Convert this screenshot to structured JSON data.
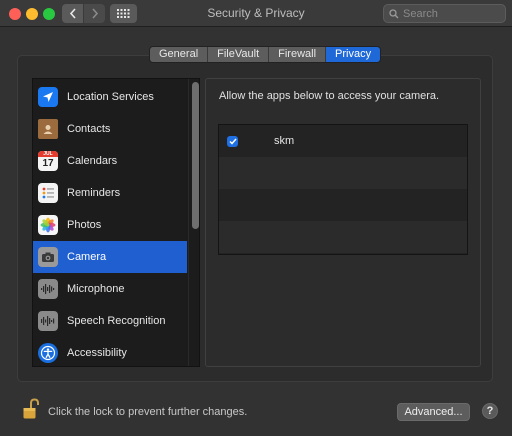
{
  "window": {
    "title": "Security & Privacy"
  },
  "search": {
    "placeholder": "Search"
  },
  "tabs": [
    {
      "label": "General"
    },
    {
      "label": "FileVault"
    },
    {
      "label": "Firewall"
    },
    {
      "label": "Privacy",
      "active": true
    }
  ],
  "sidebar": {
    "items": [
      {
        "label": "Location Services",
        "icon": "location-arrow-icon"
      },
      {
        "label": "Contacts",
        "icon": "contacts-book-icon"
      },
      {
        "label": "Calendars",
        "icon": "calendar-icon"
      },
      {
        "label": "Reminders",
        "icon": "reminders-list-icon"
      },
      {
        "label": "Photos",
        "icon": "photos-flower-icon"
      },
      {
        "label": "Camera",
        "icon": "camera-icon",
        "selected": true
      },
      {
        "label": "Microphone",
        "icon": "microphone-waveform-icon"
      },
      {
        "label": "Speech Recognition",
        "icon": "speech-waveform-icon"
      },
      {
        "label": "Accessibility",
        "icon": "accessibility-figure-icon"
      }
    ],
    "calendar_month": "JUL",
    "calendar_day": "17"
  },
  "main": {
    "description": "Allow the apps below to access your camera.",
    "apps": [
      {
        "name": "skm",
        "checked": true
      }
    ]
  },
  "footer": {
    "lock_text": "Click the lock to prevent further changes.",
    "advanced_label": "Advanced...",
    "help_label": "?"
  },
  "colors": {
    "accent": "#1f68d8",
    "selection": "#1f5fd0",
    "background": "#323232"
  }
}
